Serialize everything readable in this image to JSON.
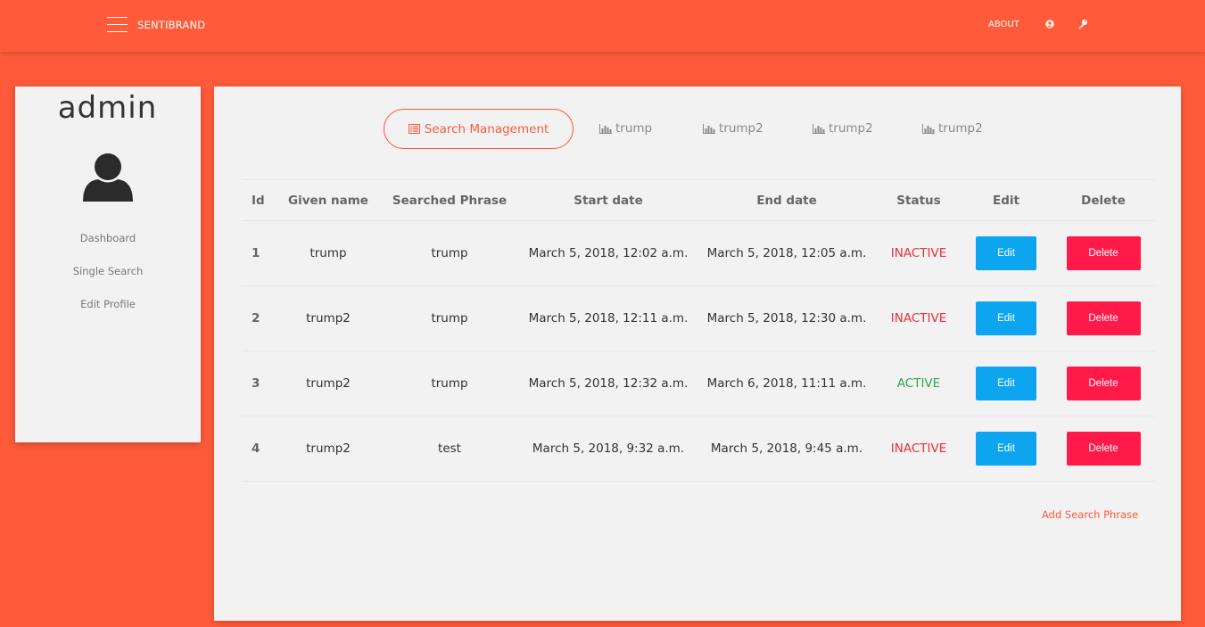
{
  "navbar": {
    "brand": "SENTIBRAND",
    "about_label": "ABOUT",
    "bg_color": "#ff5b3a"
  },
  "sidebar": {
    "username": "admin",
    "avatar_icon": "user-silhouette-icon",
    "links": [
      "Dashboard",
      "Single Search",
      "Edit Profile"
    ]
  },
  "tabs": {
    "active": {
      "icon": "list-icon",
      "label": "Search Management"
    },
    "others": [
      {
        "icon": "bar-chart-icon",
        "label": "trump"
      },
      {
        "icon": "bar-chart-icon",
        "label": "trump2"
      },
      {
        "icon": "bar-chart-icon",
        "label": "trump2"
      },
      {
        "icon": "bar-chart-icon",
        "label": "trump2"
      }
    ]
  },
  "table": {
    "headers": [
      "Id",
      "Given name",
      "Searched Phrase",
      "Start date",
      "End date",
      "Status",
      "Edit",
      "Delete"
    ],
    "rows": [
      {
        "id": "1",
        "given_name": "trump",
        "phrase": "trump",
        "start": "March 5, 2018, 12:02 a.m.",
        "end": "March 5, 2018, 12:05 a.m.",
        "status": "INACTIVE",
        "edit": "Edit",
        "delete": "Delete"
      },
      {
        "id": "2",
        "given_name": "trump2",
        "phrase": "trump",
        "start": "March 5, 2018, 12:11 a.m.",
        "end": "March 5, 2018, 12:30 a.m.",
        "status": "INACTIVE",
        "edit": "Edit",
        "delete": "Delete"
      },
      {
        "id": "3",
        "given_name": "trump2",
        "phrase": "trump",
        "start": "March 5, 2018, 12:32 a.m.",
        "end": "March 6, 2018, 11:11 a.m.",
        "status": "ACTIVE",
        "edit": "Edit",
        "delete": "Delete"
      },
      {
        "id": "4",
        "given_name": "trump2",
        "phrase": "test",
        "start": "March 5, 2018, 9:32 a.m.",
        "end": "March 5, 2018, 9:45 a.m.",
        "status": "INACTIVE",
        "edit": "Edit",
        "delete": "Delete"
      }
    ]
  },
  "add_link": "Add Search Phrase",
  "colors": {
    "accent": "#ff5b3a",
    "edit_button": "#0ea5f0",
    "delete_button": "#ff1a4a",
    "status_inactive": "#e8313a",
    "status_active": "#2aa84a"
  }
}
